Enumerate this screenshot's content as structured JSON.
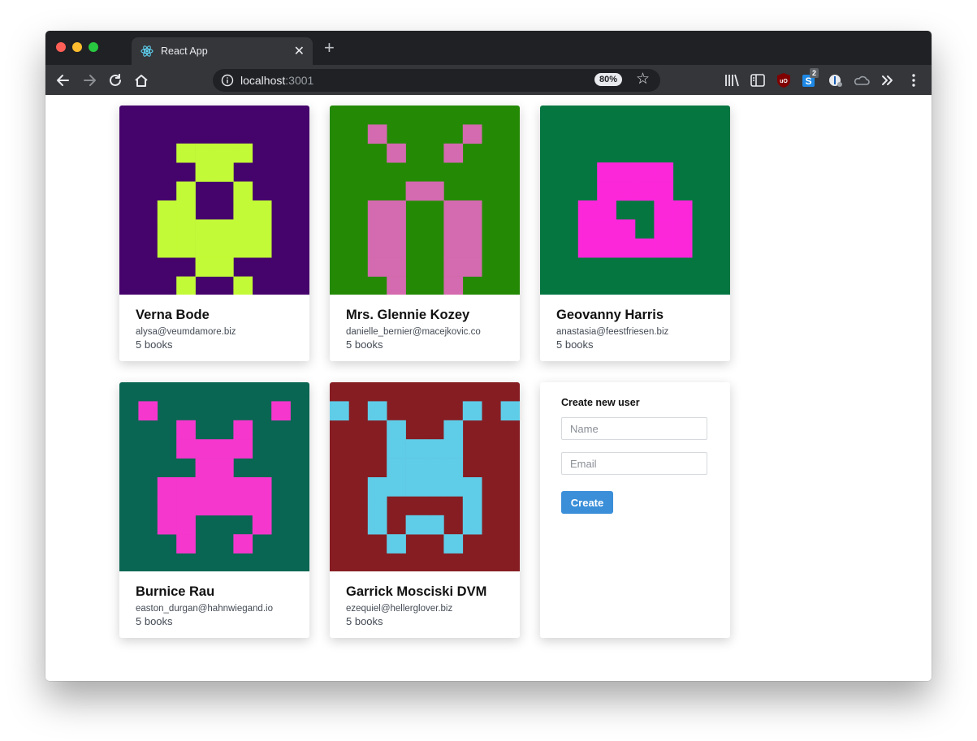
{
  "browser": {
    "tab_title": "React App",
    "url_host": "localhost",
    "url_port": ":3001",
    "zoom": "80%",
    "extension_badge": "2"
  },
  "users": [
    {
      "name": "Verna Bode",
      "email": "alysa@veumdamore.biz",
      "books": "5 books",
      "avatar": {
        "bg": "#45036c",
        "fg": "#c2fa37",
        "pattern": [
          "0000000000",
          "0000000000",
          "0003333000",
          "0000330000",
          "0003003000",
          "0033003300",
          "0033333300",
          "0033333300",
          "0000330000",
          "0003003000"
        ]
      }
    },
    {
      "name": "Mrs. Glennie Kozey",
      "email": "danielle_bernier@macejkovic.co",
      "books": "5 books",
      "avatar": {
        "bg": "#248a05",
        "fg": "#d46aaf",
        "pattern": [
          "0000000000",
          "0010000100",
          "0001001000",
          "0000000000",
          "0000110000",
          "0011001100",
          "0031001300",
          "0011001100",
          "0011001100",
          "0001001000"
        ]
      }
    },
    {
      "name": "Geovanny Harris",
      "email": "anastasia@feestfriesen.biz",
      "books": "5 books",
      "avatar": {
        "bg": "#067641",
        "fg": "#fd27da",
        "pattern": [
          "0000000000",
          "0000000000",
          "0000000000",
          "0003333000",
          "0003333000",
          "0033003300",
          "0033303300",
          "0033333300",
          "0000000000",
          "0000000000"
        ]
      }
    },
    {
      "name": "Burnice Rau",
      "email": "easton_durgan@hahnwiegand.io",
      "books": "5 books",
      "avatar": {
        "bg": "#096652",
        "fg": "#f537cd",
        "pattern": [
          "0000000000",
          "0100000010",
          "0003003000",
          "0003333000",
          "0000330000",
          "0033333300",
          "0033333300",
          "0033000300",
          "0003003000",
          "0000000000"
        ]
      }
    },
    {
      "name": "Garrick Mosciski DVM",
      "email": "ezequiel@hellerglover.biz",
      "books": "5 books",
      "avatar": {
        "bg": "#861d22",
        "fg": "#5fcde8",
        "pattern": [
          "0000000000",
          "1010000101",
          "0003003000",
          "0003333000",
          "0003333000",
          "0033333300",
          "0030000300",
          "0030330300",
          "0003003000",
          "0000000000"
        ]
      }
    }
  ],
  "form": {
    "title": "Create new user",
    "name_placeholder": "Name",
    "email_placeholder": "Email",
    "submit_label": "Create"
  }
}
